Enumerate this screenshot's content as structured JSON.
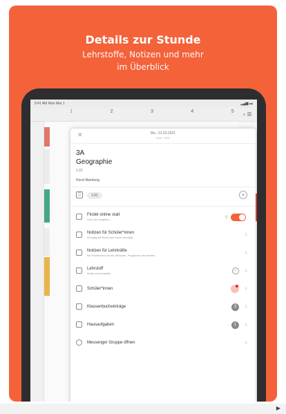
{
  "hero": {
    "title": "Details zur Stunde",
    "subtitle_line1": "Lehrstoffe, Notizen und mehr",
    "subtitle_line2": "im Überblick"
  },
  "ipad": {
    "statusbar_left": "9:41 AM  Mon Mar 1",
    "statusbar_right": "▂▄▆ ▬",
    "days": [
      "1",
      "2",
      "3",
      "4",
      "5"
    ]
  },
  "modal": {
    "close_label": "✕",
    "date": "Mo., 01.03.2021",
    "time": "8:00 - 8:50",
    "class_name": "3A",
    "subject": "Geographie",
    "room": "1.01",
    "teacher": "Horst Meinberg",
    "room_badge": "1.01",
    "rows": [
      {
        "title": "Findet online statt",
        "subtitle": "Link hier eingeben"
      },
      {
        "title": "Notizen für Schüler*innen",
        "subtitle": "Geographie Buch wird heute benötigt"
      },
      {
        "title": "Notizen für Lehrkräfte",
        "subtitle": "Bei Problemen mit der Webcam, Programm neu starten"
      },
      {
        "title": "Lehrstoff",
        "subtitle": "Arktis und Antarktis"
      },
      {
        "title": "Schüler*innen",
        "subtitle": ""
      },
      {
        "title": "Klassenbucheinträge",
        "subtitle": "",
        "badge": "3"
      },
      {
        "title": "Hausaufgaben",
        "subtitle": "",
        "badge": "1"
      },
      {
        "title": "Messenger Gruppe öffnen",
        "subtitle": ""
      }
    ]
  },
  "colors": {
    "accent": "#f4623a",
    "badge_gray": "#8a8a8a"
  }
}
